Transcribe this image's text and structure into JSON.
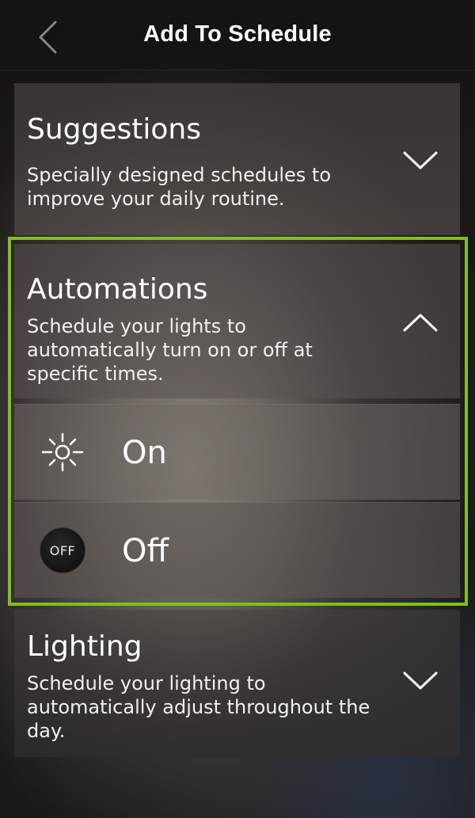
{
  "header": {
    "back_icon": "chevron-left-icon",
    "title": "Add To Schedule"
  },
  "sections": [
    {
      "title": "Suggestions",
      "description": "Specially designed schedules to improve your daily routine.",
      "expanded": false,
      "chevron_icon": "chevron-down-icon"
    },
    {
      "title": "Automations",
      "description": "Schedule your lights to automatically turn on or off at specific times.",
      "expanded": true,
      "chevron_icon": "chevron-up-icon",
      "options": [
        {
          "label": "On",
          "icon": "sun-icon"
        },
        {
          "label": "Off",
          "icon": "off-icon",
          "icon_text": "OFF"
        }
      ]
    },
    {
      "title": "Lighting",
      "description": "Schedule your lighting to automatically adjust throughout the day.",
      "expanded": false,
      "chevron_icon": "chevron-down-icon"
    }
  ],
  "colors": {
    "highlight": "#7fbf1f",
    "header_bg": "#151313",
    "text": "#ffffff"
  }
}
